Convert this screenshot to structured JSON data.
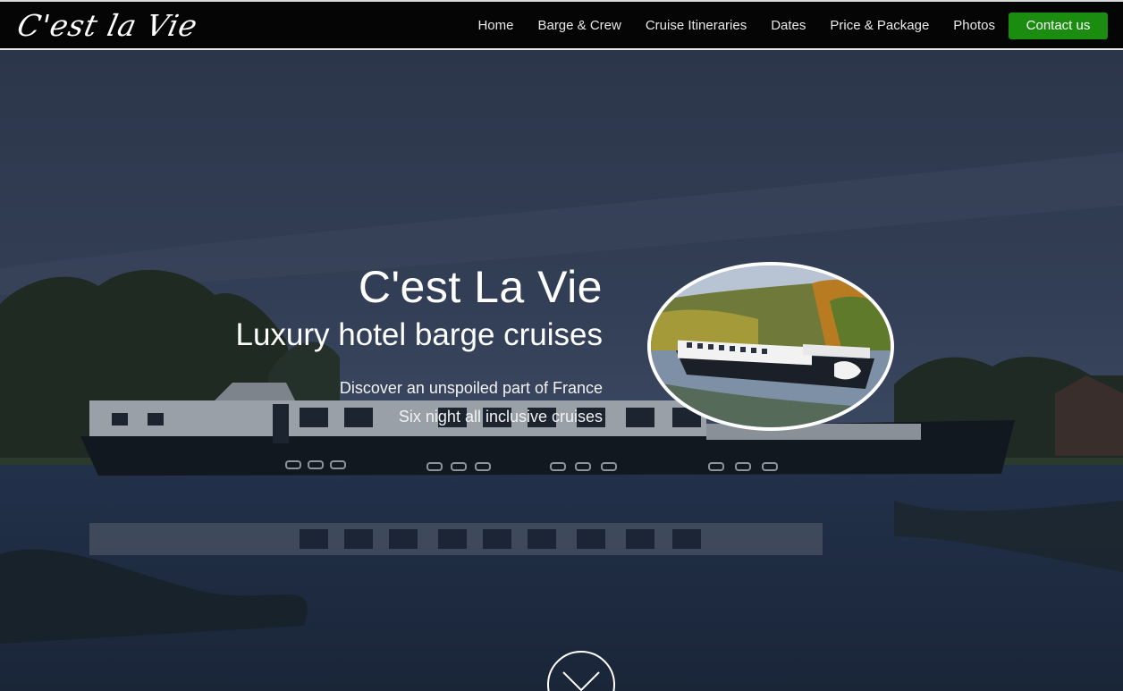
{
  "brand": {
    "logo_text": "C'est la Vie"
  },
  "nav": {
    "items": [
      {
        "label": "Home"
      },
      {
        "label": "Barge & Crew"
      },
      {
        "label": "Cruise Itineraries"
      },
      {
        "label": "Dates"
      },
      {
        "label": "Price & Package"
      },
      {
        "label": "Photos"
      }
    ],
    "contact_label": "Contact us"
  },
  "hero": {
    "title": "C'est La Vie",
    "subtitle": "Luxury hotel barge cruises",
    "line1": "Discover an unspoiled part of France",
    "line2": "Six night all inclusive cruises"
  },
  "icons": {
    "scroll": "chevron-down-icon"
  },
  "colors": {
    "navbar_bg": "#050505",
    "contact_button": "#1a8c10",
    "hero_overlay": "#1e2a3d"
  }
}
